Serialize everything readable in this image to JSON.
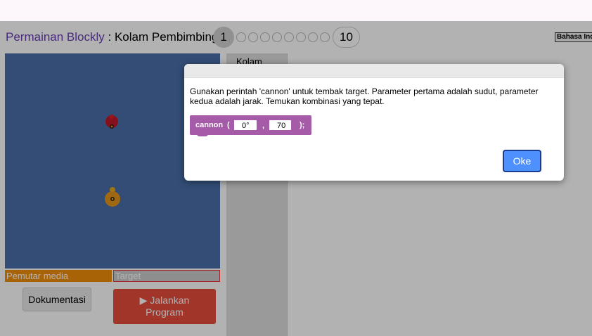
{
  "header": {
    "app_title": "Permainan Blockly",
    "separator": " : ",
    "level_title": "Kolam Pembimbing",
    "current_level": "1",
    "last_level": "10",
    "language": "Bahasa Indonesia"
  },
  "game": {
    "player_label": "Pemutar media",
    "target_label": "Target",
    "doc_button": "Dokumentasi",
    "run_button_line1": "Jalankan",
    "run_button_line2": "Program"
  },
  "toolbox": {
    "category": "Kolam"
  },
  "dialog": {
    "text": "Gunakan perintah 'cannon' untuk tembak target. Parameter pertama adalah sudut, parameter kedua adalah jarak. Temukan kombinasi yang tepat.",
    "block": {
      "name": "cannon",
      "open": "(",
      "arg1": "0°",
      "comma": ",",
      "arg2": "70",
      "close": ");"
    },
    "ok_button": "Oke"
  },
  "colors": {
    "field": "#4a6faa",
    "player_label_bg": "#f18f0b",
    "run_button": "#e74c3c",
    "block": "#a55ba8",
    "ok_button": "#4d90fe"
  }
}
